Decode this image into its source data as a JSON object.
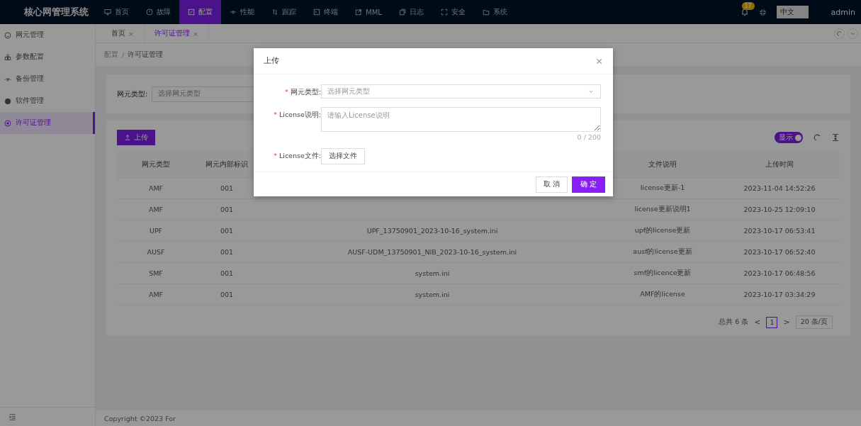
{
  "header": {
    "title": "核心网管理系统",
    "nav": [
      {
        "label": "首页",
        "selected": false
      },
      {
        "label": "故障",
        "selected": false
      },
      {
        "label": "配置",
        "selected": true
      },
      {
        "label": "性能",
        "selected": false
      },
      {
        "label": "跟踪",
        "selected": false
      },
      {
        "label": "终端",
        "selected": false
      },
      {
        "label": "MML",
        "selected": false
      },
      {
        "label": "日志",
        "selected": false
      },
      {
        "label": "安全",
        "selected": false
      },
      {
        "label": "系统",
        "selected": false
      }
    ],
    "notification_count": "17",
    "language": "中文",
    "user": "admin"
  },
  "sidebar": {
    "items": [
      {
        "label": "网元管理",
        "selected": false
      },
      {
        "label": "参数配置",
        "selected": false
      },
      {
        "label": "备份管理",
        "selected": false
      },
      {
        "label": "软件管理",
        "selected": false
      },
      {
        "label": "许可证管理",
        "selected": true
      }
    ]
  },
  "tabs": [
    {
      "label": "首页",
      "close": "×",
      "selected": false
    },
    {
      "label": "许可证管理",
      "close": "×",
      "selected": true
    }
  ],
  "breadcrumb": {
    "items": [
      "配置",
      "许可证管理"
    ],
    "separator": "/"
  },
  "search": {
    "label": "网元类型:",
    "placeholder": "选择网元类型"
  },
  "table": {
    "upload_button": "上传",
    "toggle": {
      "label": "显示",
      "on": true
    },
    "columns": [
      "网元类型",
      "网元内部标识",
      "",
      "文件说明",
      "上传时间"
    ],
    "rows": [
      [
        "AMF",
        "001",
        "",
        "license更新-1",
        "2023-11-04 14:52:26"
      ],
      [
        "AMF",
        "001",
        "",
        "license更新说明1",
        "2023-10-25 12:09:10"
      ],
      [
        "UPF",
        "001",
        "UPF_13750901_2023-10-16_system.ini",
        "upf的license更新",
        "2023-10-17 06:53:41"
      ],
      [
        "AUSF",
        "001",
        "AUSF-UDM_13750901_NIB_2023-10-16_system.ini",
        "ausf的license更新",
        "2023-10-17 06:52:40"
      ],
      [
        "SMF",
        "001",
        "system.ini",
        "smf的licence更新",
        "2023-10-17 06:48:56"
      ],
      [
        "AMF",
        "001",
        "system.ini",
        "AMF的license",
        "2023-10-17 03:34:29"
      ]
    ],
    "pagination": {
      "total": "总共 6 条",
      "prev": "<",
      "page": "1",
      "next": ">",
      "page_size": "20 条/页"
    }
  },
  "footer": "Copyright ©2023 For",
  "modal": {
    "title": "上传",
    "fields": [
      {
        "kind": "select",
        "label": "网元类型:",
        "required_mark": "*",
        "placeholder": "选择网元类型"
      },
      {
        "kind": "textarea",
        "label": "License说明:",
        "required_mark": "*",
        "placeholder": "请输入License说明",
        "counter": "0 / 200"
      },
      {
        "kind": "file",
        "label": "License文件:",
        "required_mark": "*",
        "button": "选择文件"
      }
    ],
    "cancel": "取 消",
    "ok": "确 定"
  }
}
